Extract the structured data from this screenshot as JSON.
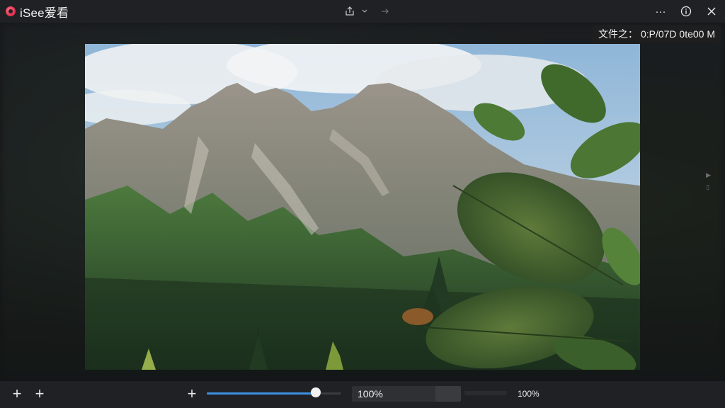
{
  "app": {
    "title": "iSee爱看"
  },
  "titlebar": {
    "share_icon": "share-icon",
    "dropdown_icon": "chevron-down-icon",
    "forward_icon": "arrow-right-icon",
    "more_label": "···",
    "info_label": "i",
    "close_label": "✕"
  },
  "file_info": {
    "label": "文件之：",
    "value": "0:P/07D 0te00 M"
  },
  "bottombar": {
    "add1_label": "+",
    "add2_label": "+",
    "add3_label": "+",
    "zoom_value": 0.81,
    "zoom_input_value": "100%",
    "zoom_label": "100%"
  },
  "colors": {
    "accent": "#3d8fe0",
    "logo": "#e0284a",
    "titlebar": "#202124"
  }
}
